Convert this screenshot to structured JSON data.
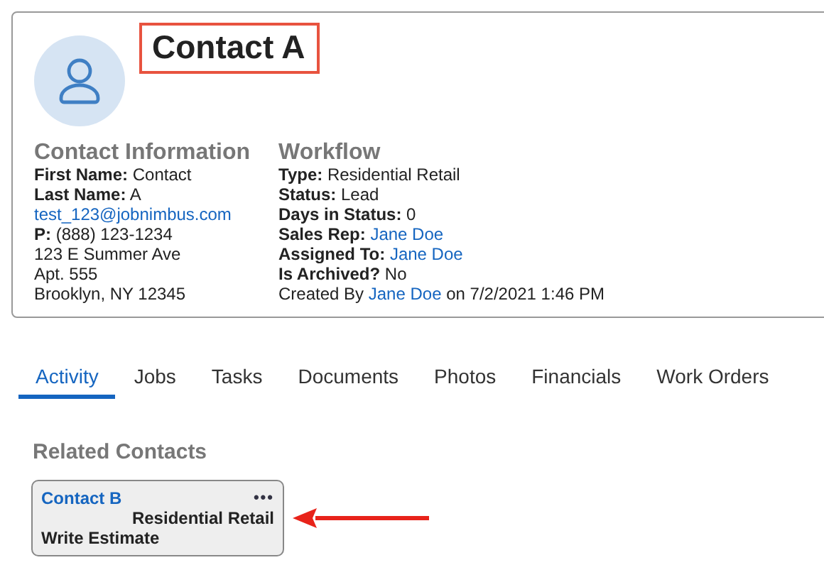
{
  "contact": {
    "name": "Contact A",
    "highlighted": true
  },
  "sections": [
    {
      "heading": "Contact Information",
      "lines": [
        [
          {
            "text": "First Name:",
            "kind": "bold"
          },
          {
            "text": " Contact",
            "kind": "plain"
          }
        ],
        [
          {
            "text": "Last Name:",
            "kind": "bold"
          },
          {
            "text": " A",
            "kind": "plain"
          }
        ],
        [
          {
            "text": "test_123@jobnimbus.com",
            "kind": "link"
          }
        ],
        [
          {
            "text": "P:",
            "kind": "bold"
          },
          {
            "text": " (888) 123-1234",
            "kind": "plain"
          }
        ],
        [
          {
            "text": "123 E Summer Ave",
            "kind": "plain"
          }
        ],
        [
          {
            "text": "Apt. 555",
            "kind": "plain"
          }
        ],
        [
          {
            "text": "Brooklyn, NY 12345",
            "kind": "plain"
          }
        ]
      ]
    },
    {
      "heading": "Workflow",
      "lines": [
        [
          {
            "text": "Type:",
            "kind": "bold"
          },
          {
            "text": " Residential Retail",
            "kind": "plain"
          }
        ],
        [
          {
            "text": "Status:",
            "kind": "bold"
          },
          {
            "text": " Lead",
            "kind": "plain"
          }
        ],
        [
          {
            "text": "Days in Status:",
            "kind": "bold"
          },
          {
            "text": " 0",
            "kind": "plain"
          }
        ],
        [
          {
            "text": "Sales Rep: ",
            "kind": "bold"
          },
          {
            "text": "Jane Doe",
            "kind": "link"
          }
        ],
        [
          {
            "text": "Assigned To: ",
            "kind": "bold"
          },
          {
            "text": "Jane Doe",
            "kind": "link"
          }
        ],
        [
          {
            "text": "Is Archived?",
            "kind": "bold"
          },
          {
            "text": " No",
            "kind": "plain"
          }
        ],
        [
          {
            "text": "Created By ",
            "kind": "plain"
          },
          {
            "text": "Jane Doe",
            "kind": "link"
          },
          {
            "text": " on 7/2/2021 1:46 PM",
            "kind": "plain"
          }
        ]
      ]
    }
  ],
  "tabs": [
    {
      "label": "Activity",
      "selected": true
    },
    {
      "label": "Jobs",
      "selected": false
    },
    {
      "label": "Tasks",
      "selected": false
    },
    {
      "label": "Documents",
      "selected": false
    },
    {
      "label": "Photos",
      "selected": false
    },
    {
      "label": "Financials",
      "selected": false
    },
    {
      "label": "Work Orders",
      "selected": false
    }
  ],
  "related": {
    "heading": "Related Contacts",
    "cards": [
      {
        "name": "Contact B",
        "menu": "•••",
        "type": "Residential Retail",
        "status": "Write Estimate",
        "pointed_at": true
      }
    ]
  }
}
